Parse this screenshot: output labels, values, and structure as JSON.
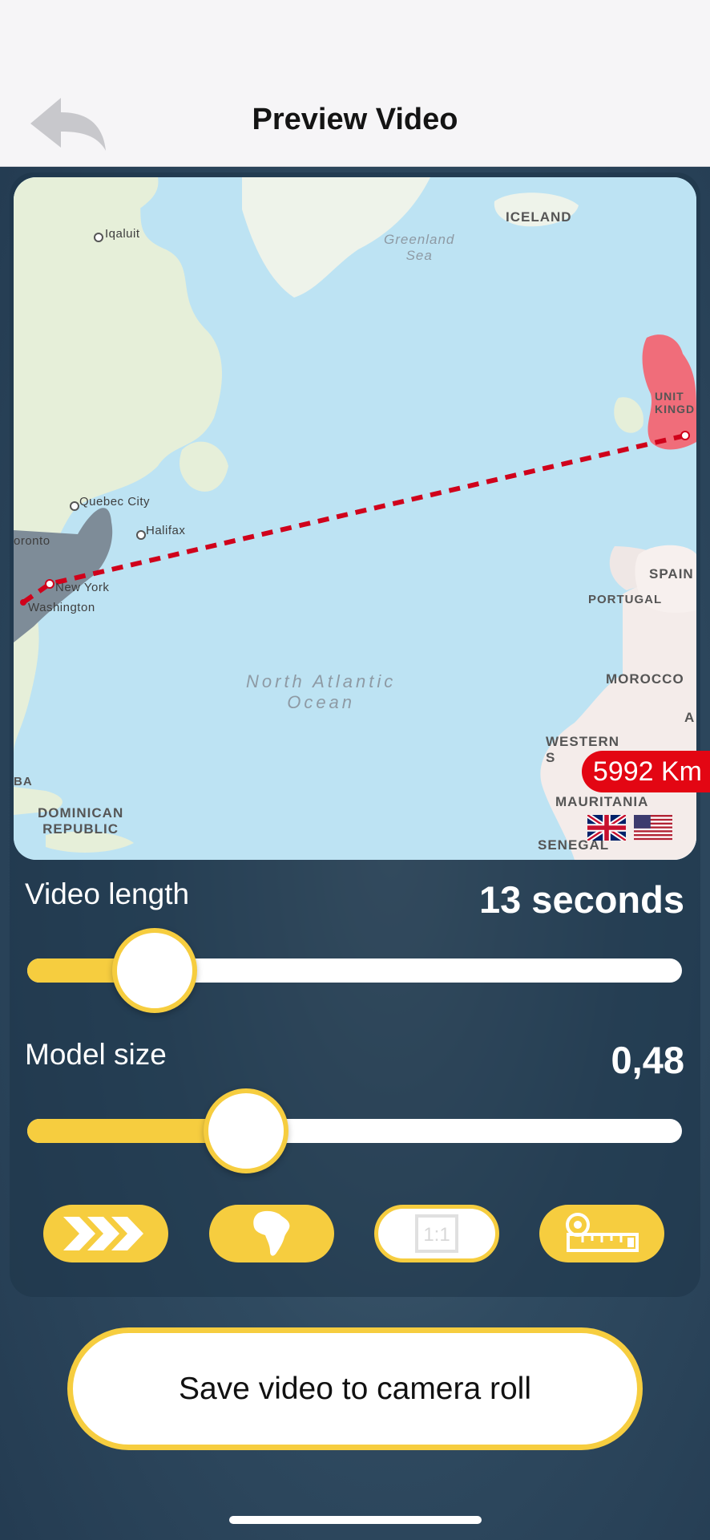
{
  "header": {
    "title": "Preview Video",
    "back_icon": "back-arrow-icon"
  },
  "map": {
    "labels": {
      "iqaluit": "Iqaluit",
      "iceland": "ICELAND",
      "greenland_sea_1": "Greenland",
      "greenland_sea_2": "Sea",
      "united_kingdom_1": "UNIT",
      "united_kingdom_2": "KINGD",
      "quebec": "Quebec City",
      "halifax": "Halifax",
      "toronto": "oronto",
      "new_york": "New York",
      "washington": "Washington",
      "spain": "SPAIN",
      "portugal": "PORTUGAL",
      "ocean_1": "North Atlantic",
      "ocean_2": "Ocean",
      "morocco": "MOROCCO",
      "algeria_partial": "A",
      "western_sahara_1": "WESTERN",
      "western_sahara_2": "S",
      "cuba": "BA",
      "dominican_1": "DOMINICAN",
      "dominican_2": "REPUBLIC",
      "mauritania": "MAURITANIA",
      "senegal": "SENEGAL"
    },
    "route": {
      "from": "Washington",
      "to": "London",
      "color": "#d0021b"
    },
    "distance_label": "5992 Km",
    "flags": [
      "uk-flag-icon",
      "us-flag-icon"
    ]
  },
  "video_length": {
    "label": "Video length",
    "value": "13 seconds",
    "fraction": 0.17
  },
  "model_size": {
    "label": "Model size",
    "value": "0,48",
    "fraction": 0.31
  },
  "option_buttons": [
    {
      "name": "fast-forward-button",
      "icon": "triple-arrow-icon",
      "active": true
    },
    {
      "name": "continent-button",
      "icon": "africa-icon",
      "active": true
    },
    {
      "name": "aspect-ratio-button",
      "icon": "aspect-ratio-icon",
      "label": "1:1",
      "active": false
    },
    {
      "name": "measure-button",
      "icon": "tape-measure-icon",
      "active": true
    }
  ],
  "save_button": {
    "label": "Save video to camera roll"
  },
  "colors": {
    "accent": "#f6cd3f",
    "route": "#d0021b",
    "distance_badge": "#e30613"
  }
}
